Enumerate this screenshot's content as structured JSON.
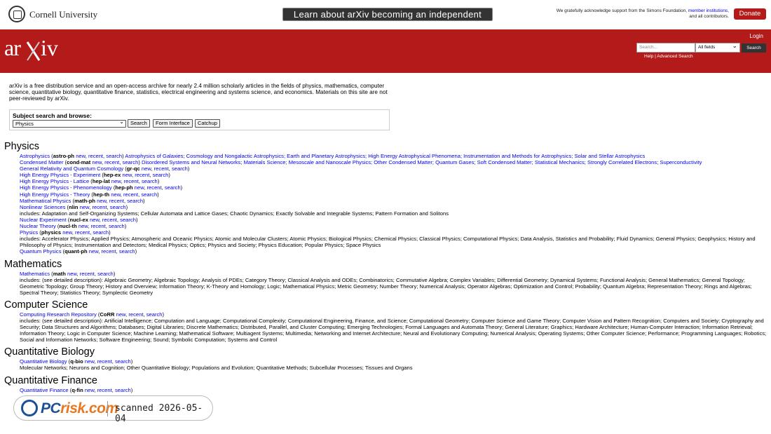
{
  "top": {
    "cornell": "Cornell University",
    "banner": "Learn about arXiv becoming an independent nonprofit.",
    "ack_prefix": "We gratefully acknowledge support from the Simons Foundation,",
    "ack_link": "member institutions",
    "ack_suffix": ", and all contributors.",
    "donate": "Donate"
  },
  "header": {
    "logo": "arXiv",
    "login": "Login",
    "search_placeholder": "Search...",
    "field": "All fields",
    "search_btn": "Search",
    "help": "Help | Advanced Search"
  },
  "intro": "arXiv is a free distribution service and an open-access archive for nearly 2.4 million scholarly articles in the fields of physics, mathematics, computer science, quantitative biology, quantitative finance, statistics, electrical engineering and systems science, and economics. Materials on this site are not peer-reviewed by arXiv.",
  "browse": {
    "title": "Subject search and browse:",
    "selected": "Physics",
    "buttons": [
      "Search",
      "Form Interface",
      "Catchup"
    ]
  },
  "sections": [
    {
      "heading": "Physics",
      "items": [
        {
          "name": "Astrophysics",
          "code": "astro-ph",
          "rest": "Astrophysics of Galaxies; Cosmology and Nongalactic Astrophysics; Earth and Planetary Astrophysics; High Energy Astrophysical Phenomena; Instrumentation and Methods for Astrophysics; Solar and Stellar Astrophysics"
        },
        {
          "name": "Condensed Matter",
          "code": "cond-mat",
          "rest": "Disordered Systems and Neural Networks; Materials Science; Mesoscale and Nanoscale Physics; Other Condensed Matter; Quantum Gases; Soft Condensed Matter; Statistical Mechanics; Strongly Correlated Electrons; Superconductivity"
        },
        {
          "name": "General Relativity and Quantum Cosmology",
          "code": "gr-qc",
          "rest": ""
        },
        {
          "name": "High Energy Physics - Experiment",
          "code": "hep-ex",
          "rest": ""
        },
        {
          "name": "High Energy Physics - Lattice",
          "code": "hep-lat",
          "rest": ""
        },
        {
          "name": "High Energy Physics - Phenomenology",
          "code": "hep-ph",
          "rest": ""
        },
        {
          "name": "High Energy Physics - Theory",
          "code": "hep-th",
          "rest": ""
        },
        {
          "name": "Mathematical Physics",
          "code": "math-ph",
          "rest": ""
        },
        {
          "name": "Nonlinear Sciences",
          "code": "nlin",
          "rest": "",
          "includes": "includes: Adaptation and Self-Organizing Systems; Cellular Automata and Lattice Gases; Chaotic Dynamics; Exactly Solvable and Integrable Systems; Pattern Formation and Solitons"
        },
        {
          "name": "Nuclear Experiment",
          "code": "nucl-ex",
          "rest": ""
        },
        {
          "name": "Nuclear Theory",
          "code": "nucl-th",
          "rest": ""
        },
        {
          "name": "Physics",
          "code": "physics",
          "rest": "",
          "includes": "includes: Accelerator Physics; Applied Physics; Atmospheric and Oceanic Physics; Atomic and Molecular Clusters; Atomic Physics; Biological Physics; Chemical Physics; Classical Physics; Computational Physics; Data Analysis, Statistics and Probability; Fluid Dynamics; General Physics; Geophysics; History and Philosophy of Physics; Instrumentation and Detectors; Medical Physics; Optics; Physics and Society; Physics Education; Popular Physics; Space Physics"
        },
        {
          "name": "Quantum Physics",
          "code": "quant-ph",
          "rest": ""
        }
      ]
    },
    {
      "heading": "Mathematics",
      "items": [
        {
          "name": "Mathematics",
          "code": "math",
          "rest": "",
          "includes": "includes: (see detailed description): Algebraic Geometry; Algebraic Topology; Analysis of PDEs; Category Theory; Classical Analysis and ODEs; Combinatorics; Commutative Algebra; Complex Variables; Differential Geometry; Dynamical Systems; Functional Analysis; General Mathematics; General Topology; Geometric Topology; Group Theory; History and Overview; Information Theory; K-Theory and Homology; Logic; Mathematical Physics; Metric Geometry; Number Theory; Numerical Analysis; Operator Algebras; Optimization and Control; Probability; Quantum Algebra; Representation Theory; Rings and Algebras; Spectral Theory; Statistics Theory; Symplectic Geometry"
        }
      ]
    },
    {
      "heading": "Computer Science",
      "items": [
        {
          "name": "Computing Research Repository",
          "code": "CoRR",
          "rest": "",
          "includes": "includes: (see detailed description): Artificial Intelligence; Computation and Language; Computational Complexity; Computational Engineering, Finance, and Science; Computational Geometry; Computer Science and Game Theory; Computer Vision and Pattern Recognition; Computers and Society; Cryptography and Security; Data Structures and Algorithms; Databases; Digital Libraries; Discrete Mathematics; Distributed, Parallel, and Cluster Computing; Emerging Technologies; Formal Languages and Automata Theory; General Literature; Graphics; Hardware Architecture; Human-Computer Interaction; Information Retrieval; Information Theory; Logic in Computer Science; Machine Learning; Mathematical Software; Multiagent Systems; Multimedia; Networking and Internet Architecture; Neural and Evolutionary Computing; Numerical Analysis; Operating Systems; Other Computer Science; Performance; Programming Languages; Robotics; Social and Information Networks; Software Engineering; Sound; Symbolic Computation; Systems and Control"
        }
      ]
    },
    {
      "heading": "Quantitative Biology",
      "items": [
        {
          "name": "Quantitative Biology",
          "code": "q-bio",
          "rest": "",
          "includes": "Molecular Networks; Neurons and Cognition; Other Quantitative Biology; Populations and Evolution; Quantitative Methods; Subcellular Processes; Tissues and Organs"
        }
      ]
    },
    {
      "heading": "Quantitative Finance",
      "items": [
        {
          "name": "Quantitative Finance",
          "code": "q-fin",
          "rest": ""
        }
      ]
    }
  ],
  "link_words": {
    "new": "new",
    "recent": "recent",
    "search": "search"
  },
  "watermark": {
    "brand": "PC",
    "brand2": "risk.com",
    "scan": "scanned 2026-05-04"
  }
}
